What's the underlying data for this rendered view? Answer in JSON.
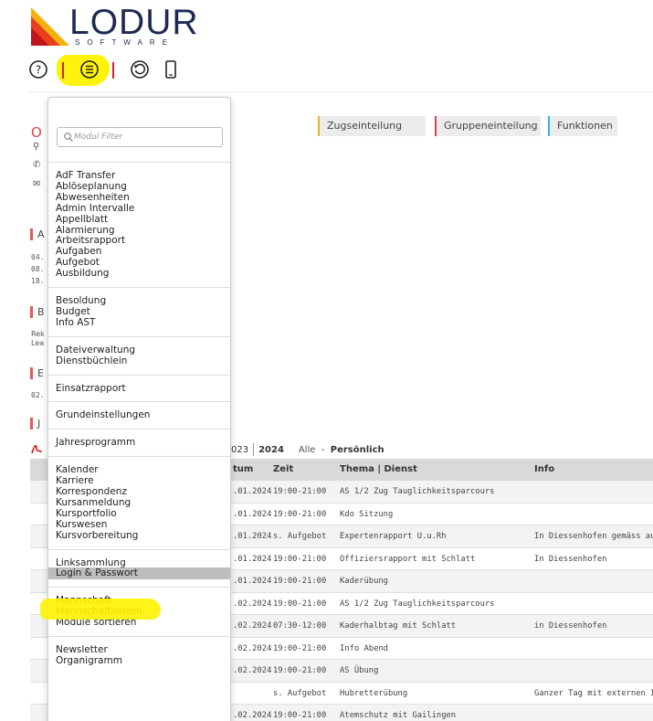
{
  "brand": {
    "name": "LODUR",
    "subtitle": "SOFTWARE"
  },
  "toolbar": {
    "buttons": [
      {
        "icon": "help-icon"
      },
      {
        "icon": "module-list-icon"
      },
      {
        "icon": "history-icon"
      },
      {
        "icon": "mobile-icon"
      }
    ]
  },
  "background": {
    "heading_initial": "O",
    "sections": [
      "A",
      "B",
      "E",
      "J"
    ],
    "date_snippets_a": [
      "04.",
      "08.",
      "18."
    ],
    "text_snippets_b": [
      "Rek",
      "Lea"
    ],
    "date_snippet_e": "02.",
    "tabs": [
      "Zugseinteilung",
      "Gruppeneinteilung",
      "Funktionen"
    ],
    "tab_colors": [
      "#e8b422",
      "#d9434c",
      "#3ab0d8"
    ],
    "year_nav": {
      "prev": "023",
      "current": "2024",
      "all": "Alle",
      "dash": "-",
      "personal": "Persönlich"
    },
    "table": {
      "headers": [
        "tum",
        "Zeit",
        "Thema | Dienst",
        "Info"
      ],
      "rows": [
        [
          ".01.2024",
          "19:00-21:00",
          "AS 1/2 Zug Tauglichkeitsparcours",
          ""
        ],
        [
          ".01.2024",
          "19:00-21:00",
          "Kdo Sitzung",
          ""
        ],
        [
          ".01.2024",
          "s. Aufgebot",
          "Expertenrapport U.u.Rh",
          "In Diessenhofen gemäss auf"
        ],
        [
          ".01.2024",
          "19:00-21:00",
          "Offiziersrapport mit Schlatt",
          "In Diessenhofen"
        ],
        [
          ".01.2024",
          "19:00-21:00",
          "Kaderübung",
          ""
        ],
        [
          ".02.2024",
          "19:00-21:00",
          "AS 1/2 Zug Tauglichkeitsparcours",
          ""
        ],
        [
          ".02.2024",
          "07:30-12:00",
          "Kaderhalbtag mit Schlatt",
          "in Diessenhofen"
        ],
        [
          ".02.2024",
          "19:00-21:00",
          "Info Abend",
          ""
        ],
        [
          ".02.2024",
          "19:00-21:00",
          "AS Übung",
          ""
        ],
        [
          "",
          "s. Aufgebot",
          "Hubretterübung",
          "Ganzer Tag mit externen Ins"
        ],
        [
          ".02.2024",
          "19:00-21:00",
          "Atemschutz mit Gailingen",
          ""
        ]
      ]
    }
  },
  "module_menu": {
    "filter_placeholder": "Modul Filter",
    "groups": [
      [
        "AdF Transfer",
        "Ablöseplanung",
        "Abwesenheiten",
        "Admin Intervalle",
        "Appellblatt",
        "Alarmierung",
        "Arbeitsrapport",
        "Aufgaben",
        "Aufgebot",
        "Ausbildung"
      ],
      [
        "Besoldung",
        "Budget",
        "Info AST"
      ],
      [
        "Dateiverwaltung",
        "Dienstbüchlein"
      ],
      [
        "Einsatzrapport"
      ],
      [
        "Grundeinstellungen"
      ],
      [
        "Jahresprogramm"
      ],
      [
        "Kalender",
        "Karriere",
        "Korrespondenz",
        "Kursanmeldung",
        "Kursportfolio",
        "Kurswesen",
        "Kursvorbereitung"
      ],
      [
        "Linksammlung",
        "Login & Passwort"
      ],
      [
        "Mannschaft",
        "Mannschaftslisten",
        "Module sortieren"
      ],
      [
        "Newsletter",
        "Organigramm"
      ]
    ],
    "active_item": "Login & Passwort"
  }
}
